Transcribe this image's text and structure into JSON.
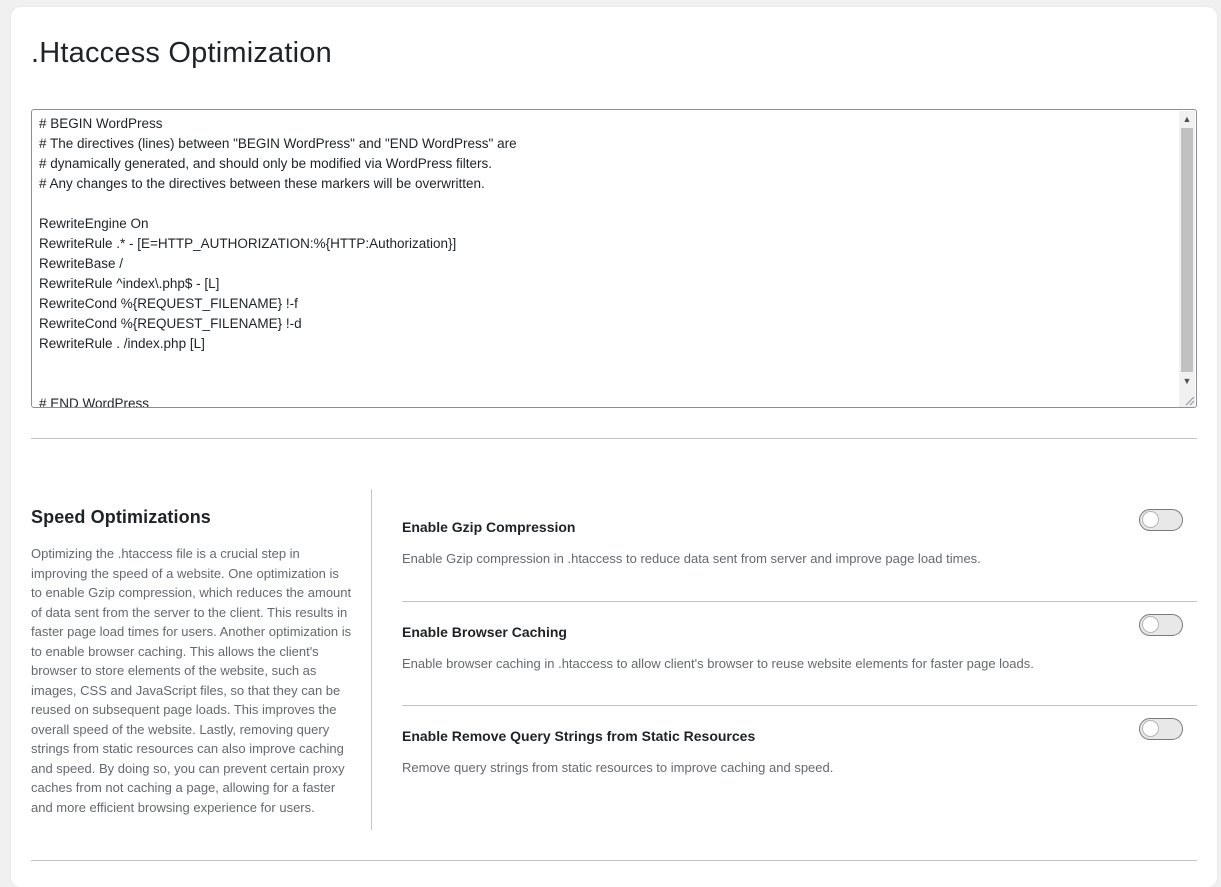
{
  "page": {
    "title": ".Htaccess Optimization"
  },
  "editor": {
    "lines": [
      "# BEGIN WordPress",
      "# The directives (lines) between \"BEGIN WordPress\" and \"END WordPress\" are",
      "# dynamically generated, and should only be modified via WordPress filters.",
      "# Any changes to the directives between these markers will be overwritten.",
      "",
      "RewriteEngine On",
      "RewriteRule .* - [E=HTTP_AUTHORIZATION:%{HTTP:Authorization}]",
      "RewriteBase /",
      "RewriteRule ^index\\.php$ - [L]",
      "RewriteCond %{REQUEST_FILENAME} !-f",
      "RewriteCond %{REQUEST_FILENAME} !-d",
      "RewriteRule . /index.php [L]",
      "",
      "",
      "# END WordPress"
    ]
  },
  "speed": {
    "title": "Speed Optimizations",
    "description": "Optimizing the .htaccess file is a crucial step in improving the speed of a website. One optimization is to enable Gzip compression, which reduces the amount of data sent from the server to the client. This results in faster page load times for users. Another optimization is to enable browser caching. This allows the client's browser to store elements of the website, such as images, CSS and JavaScript files, so that they can be reused on subsequent page loads. This improves the overall speed of the website. Lastly, removing query strings from static resources can also improve caching and speed. By doing so, you can prevent certain proxy caches from not caching a page, allowing for a faster and more efficient browsing experience for users.",
    "options": [
      {
        "title": "Enable Gzip Compression",
        "description": "Enable Gzip compression in .htaccess to reduce data sent from server and improve page load times.",
        "enabled": false
      },
      {
        "title": "Enable Browser Caching",
        "description": "Enable browser caching in .htaccess to allow client's browser to reuse website elements for faster page loads.",
        "enabled": false
      },
      {
        "title": "Enable Remove Query Strings from Static Resources",
        "description": "Remove query strings from static resources to improve caching and speed.",
        "enabled": false
      }
    ]
  },
  "icons": {
    "scroll_up": "scroll-up-arrow-icon",
    "scroll_down": "scroll-down-arrow-icon",
    "resize": "resize-grip-icon"
  }
}
